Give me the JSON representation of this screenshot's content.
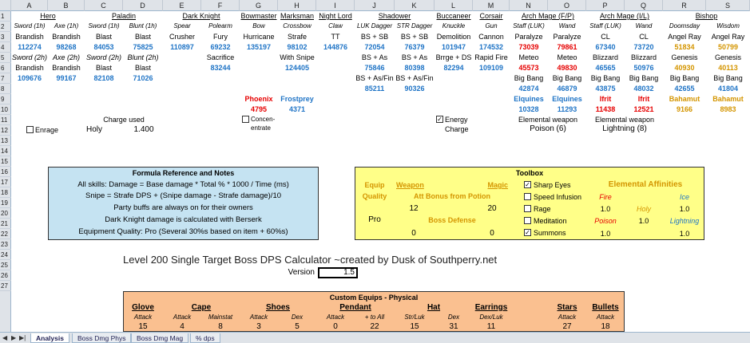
{
  "columns": [
    "A",
    "B",
    "C",
    "D",
    "E",
    "F",
    "G",
    "H",
    "I",
    "J",
    "K",
    "L",
    "M",
    "N",
    "O",
    "P",
    "Q",
    "R",
    "S"
  ],
  "rows": [
    "1",
    "2",
    "3",
    "4",
    "5",
    "6",
    "7",
    "8",
    "9",
    "10",
    "11",
    "12",
    "13",
    "14",
    "15",
    "16",
    "17",
    "18",
    "19",
    "20",
    "21",
    "22",
    "23",
    "24",
    "25",
    "26",
    "27"
  ],
  "row1": {
    "hero": "Hero",
    "paladin": "Paladin",
    "dk": "Dark Knight",
    "bowmaster": "Bowmaster",
    "marksman": "Marksman",
    "nightlord": "Night Lord",
    "shadower": "Shadower",
    "buccaneer": "Buccaneer",
    "corsair": "Corsair",
    "amfp": "Arch Mage (F/P)",
    "amil": "Arch Mage (I/L)",
    "bishop": "Bishop"
  },
  "row2": [
    "Sword (1h)",
    "Axe (1h)",
    "Sword (1h)",
    "Blunt (1h)",
    "Spear",
    "Polearm",
    "Bow",
    "Crossbow",
    "Claw",
    "LUK Dagger",
    "STR Dagger",
    "Knuckle",
    "Gun",
    "Staff (LUK)",
    "Wand",
    "Staff (LUK)",
    "Wand",
    "Doomsday",
    "Wisdom"
  ],
  "row3": [
    "Brandish",
    "Brandish",
    "Blast",
    "Blast",
    "Crusher",
    "Fury",
    "Hurricane",
    "Strafe",
    "TT",
    "BS + SB",
    "BS + SB",
    "Demolition",
    "Cannon",
    "Paralyze",
    "Paralyze",
    "CL",
    "CL",
    "Angel Ray",
    "Angel Ray"
  ],
  "row4": [
    "112274",
    "98268",
    "84053",
    "75825",
    "110897",
    "69232",
    "135197",
    "98102",
    "144876",
    "72054",
    "76379",
    "101947",
    "174532",
    "73039",
    "79861",
    "67340",
    "73720",
    "51834",
    "50799"
  ],
  "row5": {
    "a": "Sword (2h)",
    "b": "Axe (2h)",
    "c": "Sword (2h)",
    "d": "Blunt (2h)",
    "f": "Sacrifice",
    "h": "With Snipe",
    "j": "BS + As",
    "k": "BS + As",
    "l": "Brrge + DS",
    "m": "Rapid Fire",
    "n": "Meteo",
    "o": "Meteo",
    "p": "Blizzard",
    "q": "Blizzard",
    "r": "Genesis",
    "s": "Genesis"
  },
  "row6": {
    "a": "Brandish",
    "b": "Brandish",
    "c": "Blast",
    "d": "Blast",
    "f": "83244",
    "h": "124405",
    "j": "75846",
    "k": "80398",
    "l": "82294",
    "m": "109109",
    "n": "45573",
    "o": "49830",
    "p": "46565",
    "q": "50976",
    "r": "40930",
    "s": "40113"
  },
  "row7": {
    "a": "109676",
    "b": "99167",
    "c": "82108",
    "d": "71026",
    "jk": "BS + As/Fin",
    "k": "BS + As/Fin",
    "n": "Big Bang",
    "o": "Big Bang",
    "p": "Big Bang",
    "q": "Big Bang",
    "r": "Big Bang",
    "s": "Big Bang"
  },
  "row8": {
    "j": "85211",
    "k": "90326",
    "n": "42874",
    "o": "46879",
    "p": "43875",
    "q": "48032",
    "r": "42655",
    "s": "41804"
  },
  "row9": {
    "g": "Phoenix",
    "h": "Frostprey",
    "n": "Elquines",
    "o": "Elquines",
    "p": "Ifrit",
    "q": "Ifrit",
    "r": "Bahamut",
    "s": "Bahamut"
  },
  "row10": {
    "g": "4795",
    "h": "4371",
    "n": "10328",
    "o": "11293",
    "p": "11438",
    "q": "12521",
    "r": "9166",
    "s": "8983"
  },
  "row11": {
    "charge_used": "Charge used",
    "n": "Elemental weapon",
    "p": "Elemental weapon"
  },
  "row12": {
    "enrage": "Enrage",
    "holy": "Holy",
    "val": "1.400",
    "concentrate": "Concen-",
    "concentrate2": "entrate",
    "energy": "Energy",
    "energy2": "Charge",
    "poison": "Poison (6)",
    "lightning": "Lightning (8)"
  },
  "formula": {
    "title": "Formula Reference and Notes",
    "lines": [
      "All skills: Damage = Base damage * Total % * 1000 / Time (ms)",
      "Snipe = Strafe DPS + (Snipe damage - Strafe damage)/10",
      "Party buffs are always on for their owners",
      "Dark Knight damage is calculated with Berserk",
      "Equipment Quality: Pro (Several 30%s based on item + 60%s)"
    ]
  },
  "toolbox": {
    "title": "Toolbox",
    "equip": "Equip",
    "weapon": "Weapon",
    "magic": "Magic",
    "quality": "Quality",
    "att_bonus": "Att Bonus from Potion",
    "v12": "12",
    "v20": "20",
    "pro": "Pro",
    "boss_def": "Boss Defense",
    "v0a": "0",
    "v0b": "0",
    "sharp": "Sharp Eyes",
    "speed": "Speed Infusion",
    "rage": "Rage",
    "meditation": "Meditation",
    "summons": "Summons",
    "elem_title": "Elemental Affinities",
    "fire": "Fire",
    "ice": "Ice",
    "holy": "Holy",
    "poison": "Poison",
    "lightning": "Lightning",
    "f1": "1.0",
    "f2": "1.0",
    "h1": "1.0",
    "p1": "1.0",
    "p2": "1.0",
    "l1": "1.0",
    "l2": "1.0"
  },
  "title": "Level 200 Single Target Boss DPS Calculator ~created by Dusk of Southperry.net",
  "version_label": "Version",
  "version": "1.5",
  "custom": {
    "title": "Custom Equips - Physical",
    "glove": "Glove",
    "cape": "Cape",
    "shoes": "Shoes",
    "pendant": "Pendant",
    "hat": "Hat",
    "earrings": "Earrings",
    "stars": "Stars",
    "bullets": "Bullets",
    "attack": "Attack",
    "mainstat": "Mainstat",
    "dex": "Dex",
    "toall": "+ to All",
    "strluk": "Str/Luk",
    "dexluk": "Dex/Luk",
    "r27": [
      "15",
      "4",
      "8",
      "3",
      "5",
      "0",
      "22",
      "15",
      "31",
      "11",
      "27",
      "18"
    ]
  },
  "tabs": [
    "Analysis",
    "Boss Dmg Phys",
    "Boss Dmg Mag",
    "% dps"
  ]
}
